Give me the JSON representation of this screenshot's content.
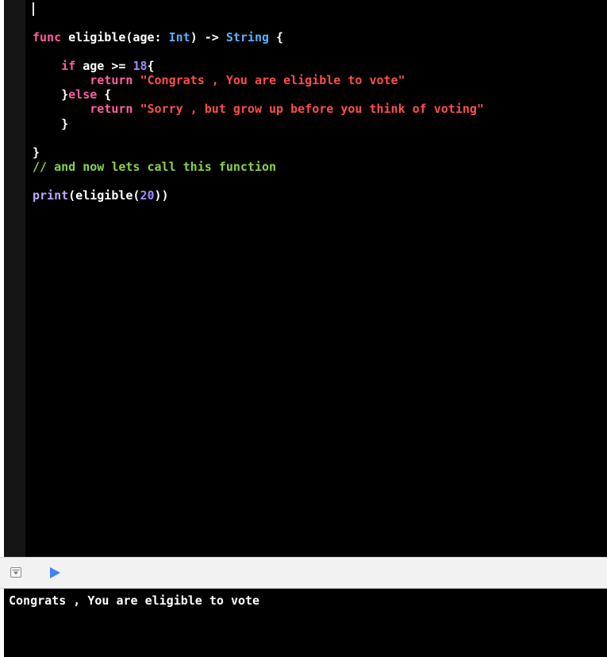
{
  "editor": {
    "lines": [
      [
        {
          "t": "func",
          "c": "kw"
        },
        {
          "t": " eligible(age: ",
          "c": "plain"
        },
        {
          "t": "Int",
          "c": "ty"
        },
        {
          "t": ") -> ",
          "c": "plain"
        },
        {
          "t": "String",
          "c": "ty"
        },
        {
          "t": " {",
          "c": "plain"
        }
      ],
      [],
      [
        {
          "t": "    ",
          "c": "plain"
        },
        {
          "t": "if",
          "c": "kw"
        },
        {
          "t": " age >= ",
          "c": "plain"
        },
        {
          "t": "18",
          "c": "num"
        },
        {
          "t": "{",
          "c": "plain"
        }
      ],
      [
        {
          "t": "        ",
          "c": "plain"
        },
        {
          "t": "return",
          "c": "kw"
        },
        {
          "t": " ",
          "c": "plain"
        },
        {
          "t": "\"Congrats , You are eligible to vote\"",
          "c": "str"
        }
      ],
      [
        {
          "t": "    }",
          "c": "plain"
        },
        {
          "t": "else",
          "c": "kw"
        },
        {
          "t": " {",
          "c": "plain"
        }
      ],
      [
        {
          "t": "        ",
          "c": "plain"
        },
        {
          "t": "return",
          "c": "kw"
        },
        {
          "t": " ",
          "c": "plain"
        },
        {
          "t": "\"Sorry , but grow up before you think of voting\"",
          "c": "str"
        }
      ],
      [
        {
          "t": "    }",
          "c": "plain"
        }
      ],
      [],
      [
        {
          "t": "}",
          "c": "plain"
        }
      ],
      [
        {
          "t": "// and now lets call this function",
          "c": "cmt"
        }
      ],
      [],
      [
        {
          "t": "print",
          "c": "fn"
        },
        {
          "t": "(eligible(",
          "c": "plain"
        },
        {
          "t": "20",
          "c": "num"
        },
        {
          "t": "))",
          "c": "plain"
        }
      ]
    ]
  },
  "toolbar": {
    "toggle_icon": "console-toggle-icon",
    "run_icon": "play-icon",
    "run_color": "#3b82f6"
  },
  "console": {
    "output": "Congrats , You are eligible to vote"
  },
  "colors": {
    "editor_bg": "#000000",
    "keyword": "#ff5fa2",
    "type": "#5ab1ff",
    "string": "#ff4d4d",
    "number": "#9e8cff",
    "comment": "#8ad24a"
  }
}
